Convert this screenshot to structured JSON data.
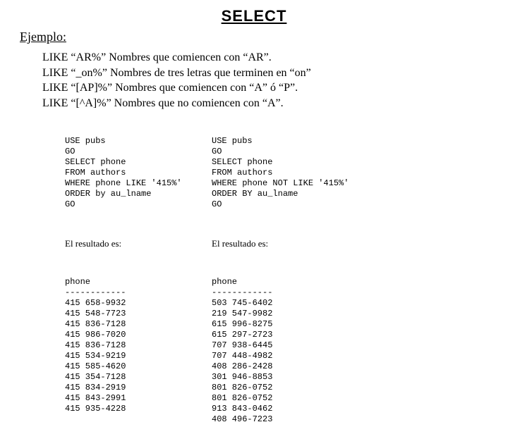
{
  "title": "SELECT",
  "subheading": "Ejemplo:",
  "bullets": [
    "LIKE “AR%”  Nombres que comiencen con “AR”.",
    "LIKE “_on%” Nombres de tres letras que terminen en “on”",
    "LIKE “[AP]%” Nombres que comiencen con “A” ó “P”.",
    "LIKE “[^A]%” Nombres que no comiencen con “A”."
  ],
  "left": {
    "sql": "USE pubs\nGO\nSELECT phone\nFROM authors\nWHERE phone LIKE '415%'\nORDER by au_lname\nGO",
    "result_label": "El resultado es:",
    "result": "phone\n------------\n415 658-9932\n415 548-7723\n415 836-7128\n415 986-7020\n415 836-7128\n415 534-9219\n415 585-4620\n415 354-7128\n415 834-2919\n415 843-2991\n415 935-4228"
  },
  "right": {
    "sql": "USE pubs\nGO\nSELECT phone\nFROM authors\nWHERE phone NOT LIKE '415%'\nORDER BY au_lname\nGO",
    "result_label": "El resultado es:",
    "result": "phone\n------------\n503 745-6402\n219 547-9982\n615 996-8275\n615 297-2723\n707 938-6445\n707 448-4982\n408 286-2428\n301 946-8853\n801 826-0752\n801 826-0752\n913 843-0462\n408 496-7223"
  }
}
